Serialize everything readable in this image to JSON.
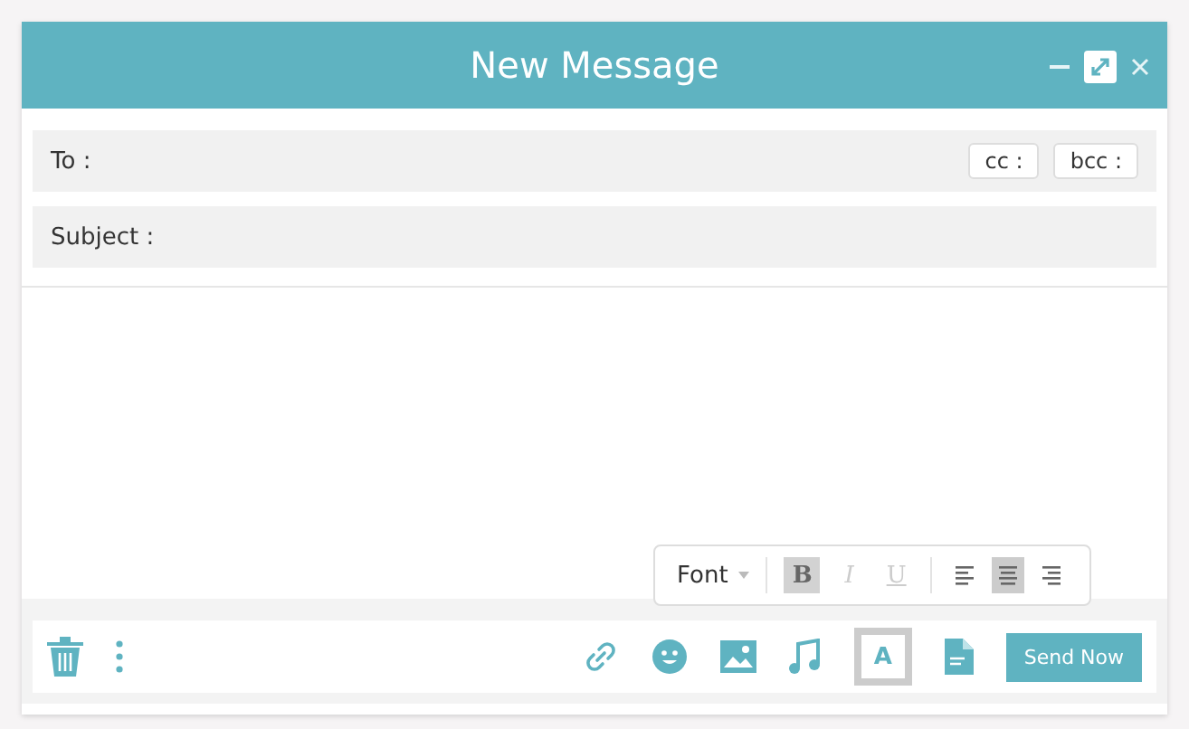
{
  "window": {
    "title": "New Message"
  },
  "fields": [
    {
      "label": "To :"
    },
    {
      "label": "Subject :"
    }
  ],
  "recipient_buttons": [
    "cc :",
    "bcc :"
  ],
  "format_bar": {
    "font": "Font",
    "styles": [
      {
        "label": "B",
        "selected": true
      },
      {
        "label": "I",
        "selected": false
      },
      {
        "label": "U",
        "selected": false
      }
    ],
    "align": [
      {
        "kind": "left",
        "selected": false
      },
      {
        "kind": "center",
        "selected": true
      },
      {
        "kind": "right",
        "selected": false
      }
    ]
  },
  "tools": [
    {
      "kind": "link",
      "selected": false
    },
    {
      "kind": "emoji",
      "selected": false
    },
    {
      "kind": "image",
      "selected": false
    },
    {
      "kind": "music",
      "selected": false
    },
    {
      "kind": "text",
      "label": "A",
      "selected": true
    },
    {
      "kind": "file",
      "selected": false
    }
  ],
  "send_button": "Send Now"
}
